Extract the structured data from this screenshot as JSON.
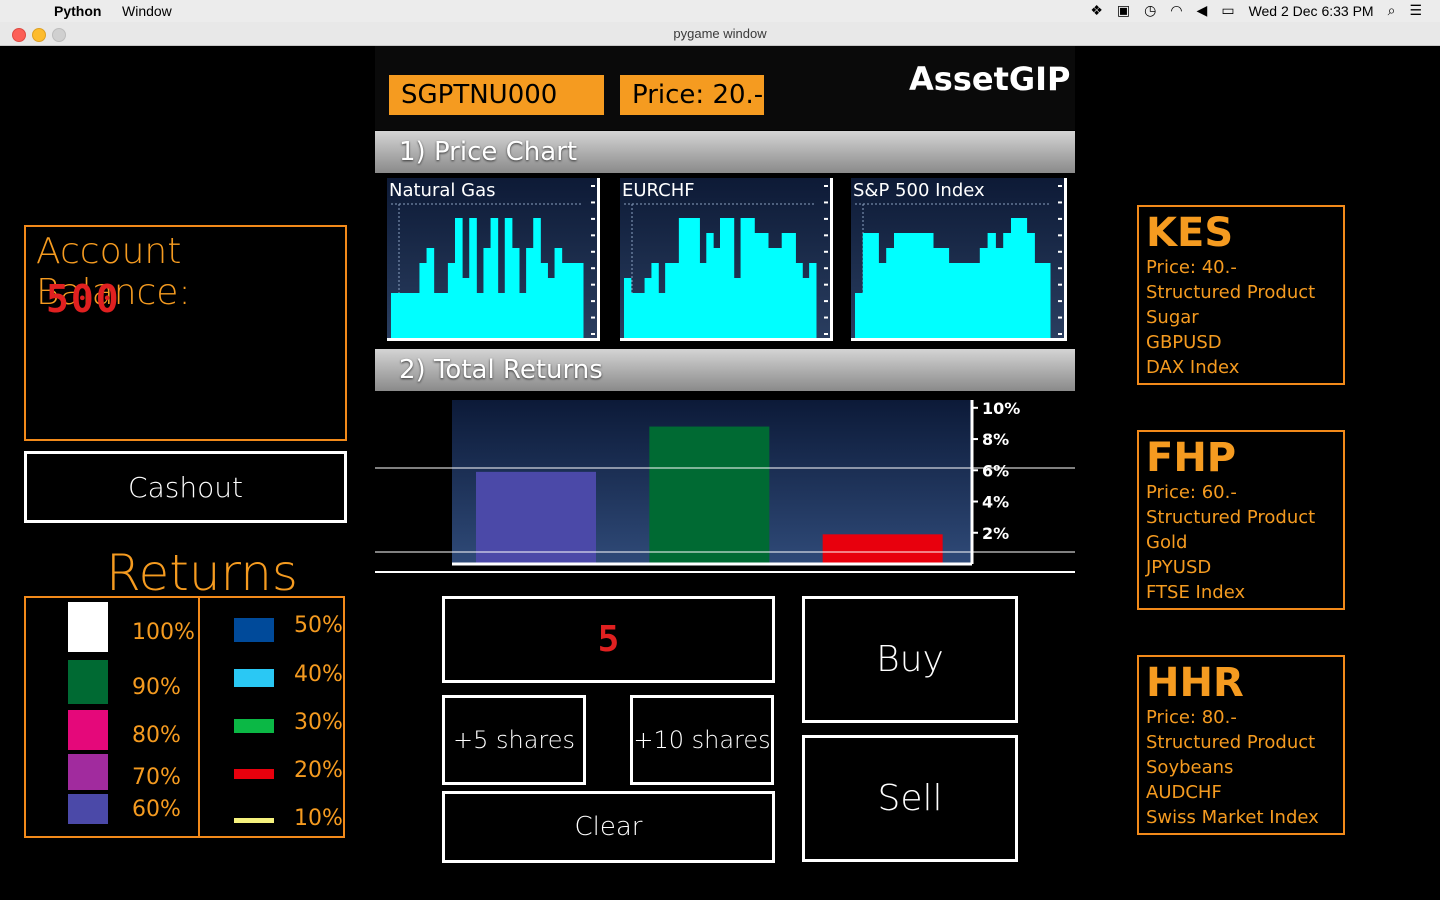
{
  "menubar": {
    "app_name": "Python",
    "menu_window": "Window",
    "clock": "Wed 2 Dec  6:33 PM"
  },
  "window": {
    "title": "pygame window"
  },
  "colors": {
    "orange": "#f59b20",
    "red_digits": "#e02020",
    "cyan_bars": "#00ffff"
  },
  "account": {
    "label": "Account Balance:",
    "value": "500"
  },
  "cashout_label": "Cashout",
  "returns_legend": {
    "title": "Returns",
    "left": [
      {
        "label": "100%",
        "color": "#ffffff"
      },
      {
        "label": "90%",
        "color": "#006a33"
      },
      {
        "label": "80%",
        "color": "#e5087a"
      },
      {
        "label": "70%",
        "color": "#a12b9e"
      },
      {
        "label": "60%",
        "color": "#4b49a8"
      }
    ],
    "right": [
      {
        "label": "50%",
        "color": "#004a9a"
      },
      {
        "label": "40%",
        "color": "#2ac8f4"
      },
      {
        "label": "30%",
        "color": "#0bb845"
      },
      {
        "label": "20%",
        "color": "#e8000d"
      },
      {
        "label": "10%",
        "color": "#f6f27e"
      }
    ]
  },
  "header": {
    "ticker": "SGPTNU000",
    "price": "Price: 20.-",
    "brand": "AssetGIP"
  },
  "sections": {
    "price_chart": "1) Price Chart",
    "total_returns": "2) Total Returns"
  },
  "chart_data": [
    {
      "type": "bar",
      "title": "Natural Gas",
      "values": [
        3,
        3,
        3,
        3,
        5,
        6,
        3,
        3,
        5,
        8,
        4,
        8,
        3,
        6,
        8,
        3,
        8,
        6,
        3,
        6,
        8,
        5,
        4,
        6,
        5,
        5,
        5
      ]
    },
    {
      "type": "bar",
      "title": "EURCHF",
      "values": [
        4,
        3,
        3,
        4,
        5,
        3,
        5,
        5,
        8,
        8,
        8,
        5,
        7,
        6,
        8,
        8,
        4,
        8,
        8,
        7,
        7,
        6,
        6,
        7,
        7,
        5,
        4,
        5
      ]
    },
    {
      "type": "bar",
      "title": "S&P 500 Index",
      "values": [
        3,
        7,
        7,
        5,
        6,
        7,
        7,
        7,
        7,
        7,
        6,
        6,
        5,
        5,
        5,
        5,
        6,
        7,
        6,
        7,
        8,
        8,
        7,
        5,
        5
      ]
    },
    {
      "type": "bar",
      "title": "",
      "categories": [
        "",
        "",
        ""
      ],
      "values": [
        5.9,
        8.8,
        1.9
      ],
      "colors": [
        "#4b49a8",
        "#006a33",
        "#e8000d"
      ],
      "ytick_labels": [
        "10%",
        "8%",
        "6%",
        "4%",
        "2%"
      ],
      "ylim": [
        0,
        10.5
      ]
    }
  ],
  "trade": {
    "quantity": "5",
    "add5": "+5 shares",
    "add10": "+10 shares",
    "clear": "Clear",
    "buy": "Buy",
    "sell": "Sell"
  },
  "assets": [
    {
      "code": "KES",
      "price": "Price: 40.-",
      "type": "Structured Product",
      "items": [
        "Sugar",
        "GBPUSD",
        "DAX Index"
      ]
    },
    {
      "code": "FHP",
      "price": "Price: 60.-",
      "type": "Structured Product",
      "items": [
        "Gold",
        "JPYUSD",
        "FTSE Index"
      ]
    },
    {
      "code": "HHR",
      "price": "Price: 80.-",
      "type": "Structured Product",
      "items": [
        "Soybeans",
        "AUDCHF",
        "Swiss Market Index"
      ]
    }
  ]
}
